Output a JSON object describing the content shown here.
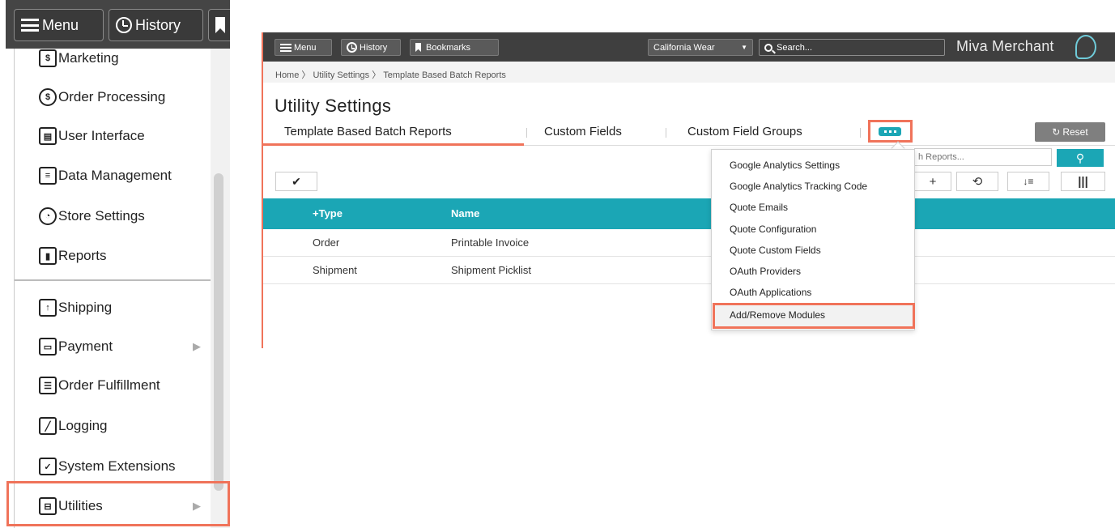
{
  "left_panel": {
    "menu_label": "Menu",
    "history_label": "History",
    "items": [
      {
        "label": "Marketing",
        "icon": "dollar-badge-icon"
      },
      {
        "label": "Order Processing",
        "icon": "dollar-cycle-icon"
      },
      {
        "label": "User Interface",
        "icon": "interface-icon"
      },
      {
        "label": "Data Management",
        "icon": "database-icon"
      },
      {
        "label": "Store Settings",
        "icon": "gauge-icon"
      },
      {
        "label": "Reports",
        "icon": "bar-chart-icon"
      },
      {
        "label": "Shipping",
        "icon": "box-icon"
      },
      {
        "label": "Payment",
        "icon": "credit-card-icon"
      },
      {
        "label": "Order Fulfillment",
        "icon": "list-icon"
      },
      {
        "label": "Logging",
        "icon": "pencil-icon"
      },
      {
        "label": "System Extensions",
        "icon": "monitor-check-icon"
      },
      {
        "label": "Utilities",
        "icon": "toolbox-icon"
      }
    ]
  },
  "topbar": {
    "menu_label": "Menu",
    "history_label": "History",
    "bookmarks_label": "Bookmarks",
    "store_label": "California Wear",
    "search_placeholder": "Search...",
    "brand": "Miva Merchant"
  },
  "breadcrumb": "Home  〉 Utility Settings  〉 Template Based Batch Reports",
  "page_title": "Utility Settings",
  "tabs": [
    {
      "label": "Template Based Batch Reports"
    },
    {
      "label": "Custom Fields"
    },
    {
      "label": "Custom Field Groups"
    }
  ],
  "reset_label": "Reset",
  "search_placeholder": "h Reports...",
  "table": {
    "headers": [
      "+Type",
      "Name"
    ],
    "rows": [
      {
        "type": "Order",
        "name": "Printable Invoice"
      },
      {
        "type": "Shipment",
        "name": "Shipment Picklist"
      }
    ]
  },
  "dropdown": [
    "Google Analytics Settings",
    "Google Analytics Tracking Code",
    "Quote Emails",
    "Quote Configuration",
    "Quote Custom Fields",
    "OAuth Providers",
    "OAuth Applications",
    "Add/Remove Modules"
  ],
  "colors": {
    "accent": "#1ba6b5",
    "highlight": "#f0735a",
    "topbar": "#3f3f3f"
  }
}
